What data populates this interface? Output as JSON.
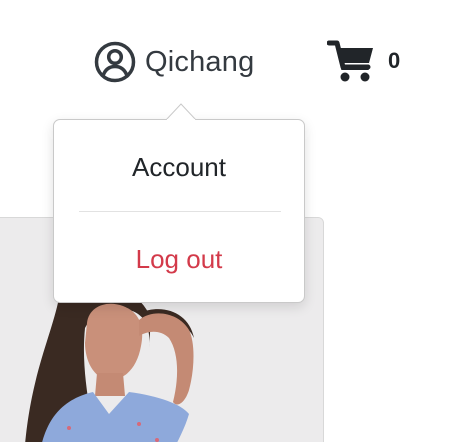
{
  "header": {
    "user_name": "Qichang",
    "user_icon": "user-circle-icon",
    "cart_icon": "shopping-cart-icon",
    "cart_count": "0"
  },
  "user_dropdown": {
    "items": [
      {
        "label": "Account"
      },
      {
        "label": "Log out"
      }
    ],
    "logout_color": "#d33a4a"
  },
  "product_card": {
    "image": "woman-in-blue-polka-dot-top-photo"
  }
}
